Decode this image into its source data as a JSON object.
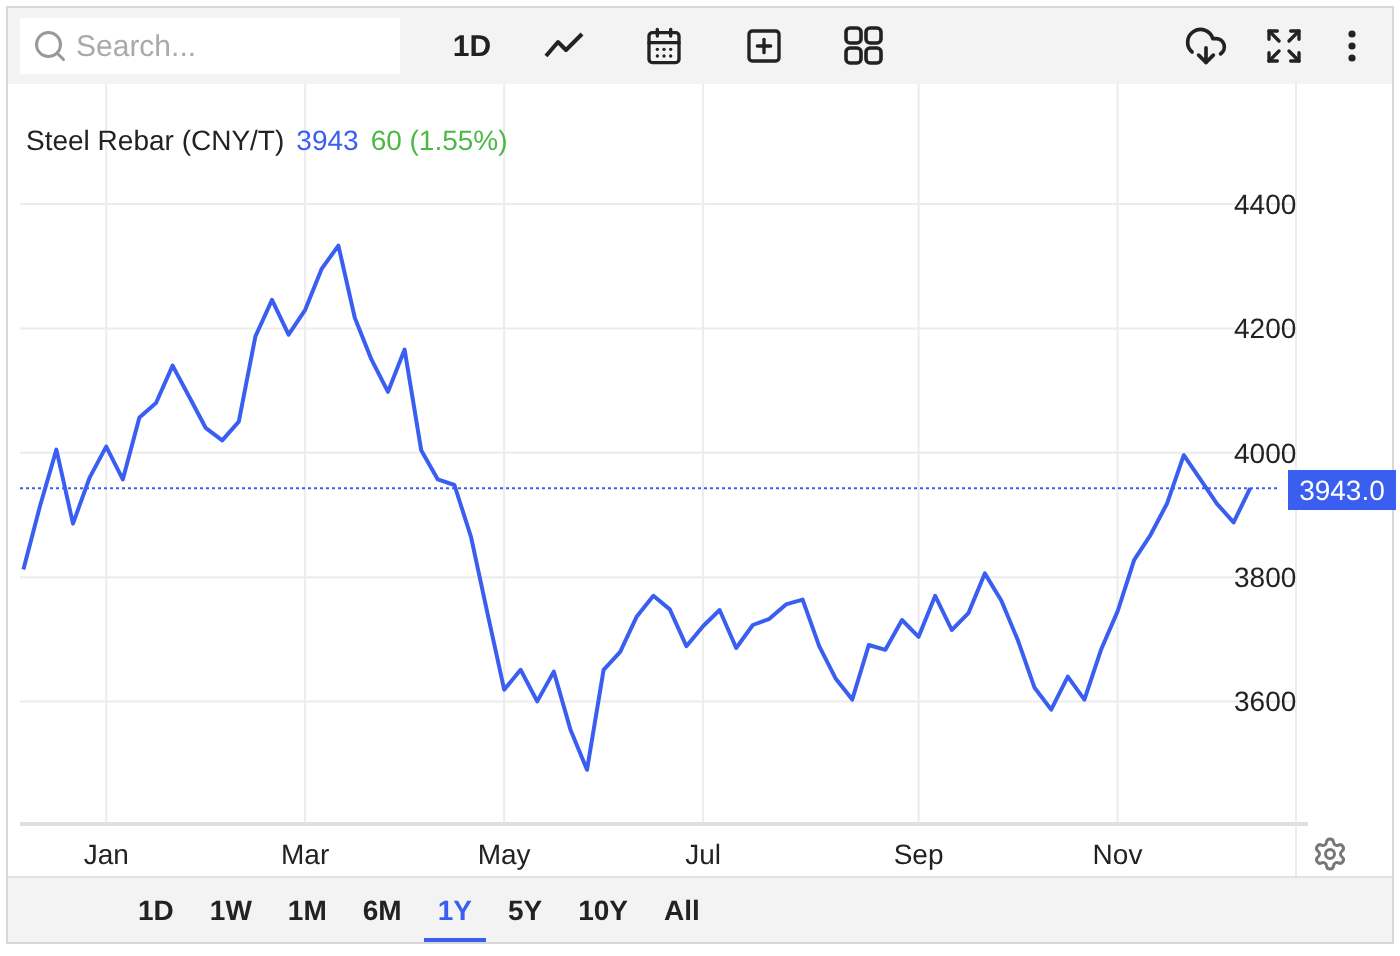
{
  "toolbar": {
    "search": {
      "placeholder": "Search..."
    },
    "interval": "1D"
  },
  "chart": {
    "legend": {
      "name": "Steel Rebar (CNY/T)",
      "price": "3943",
      "change": "60 (1.55%)"
    },
    "last_label": "3943.0",
    "chart_data": {
      "type": "line",
      "grid": true,
      "ylim": [
        3403,
        4593
      ],
      "ref_lines": [
        {
          "axis": "y",
          "value": 3943,
          "color": "#3a5ff0"
        }
      ],
      "categories": [
        null,
        null,
        null,
        null,
        null,
        "Jan",
        null,
        null,
        null,
        null,
        null,
        null,
        null,
        null,
        null,
        null,
        null,
        "Mar",
        null,
        null,
        null,
        null,
        null,
        null,
        null,
        null,
        null,
        null,
        null,
        "May",
        null,
        null,
        null,
        null,
        null,
        null,
        null,
        null,
        null,
        null,
        null,
        "Jul",
        null,
        null,
        null,
        null,
        null,
        null,
        null,
        null,
        null,
        null,
        null,
        null,
        "Sep",
        null,
        null,
        null,
        null,
        null,
        null,
        null,
        null,
        null,
        null,
        null,
        "Nov",
        null,
        null,
        null,
        null,
        null,
        null,
        null,
        null
      ],
      "yticks": [
        3600,
        3800,
        4000,
        4200,
        4400
      ],
      "series": [
        {
          "color": "#3a5ff0",
          "values": [
            3812,
            3913,
            4005,
            3886,
            3960,
            4010,
            3957,
            4057,
            4080,
            4140,
            4090,
            4040,
            4020,
            4050,
            4187,
            4246,
            4190,
            4230,
            4296,
            4333,
            4217,
            4150,
            4098,
            4166,
            4004,
            3957,
            3948,
            3865,
            3741,
            3619,
            3651,
            3600,
            3648,
            3555,
            3490,
            3651,
            3680,
            3737,
            3770,
            3748,
            3689,
            3721,
            3747,
            3686,
            3723,
            3733,
            3756,
            3764,
            3689,
            3637,
            3603,
            3691,
            3683,
            3731,
            3704,
            3770,
            3715,
            3742,
            3806,
            3762,
            3698,
            3622,
            3587,
            3640,
            3603,
            3683,
            3745,
            3828,
            3868,
            3919,
            3996,
            3957,
            3918,
            3888,
            3943
          ]
        }
      ]
    }
  },
  "ranges": [
    {
      "label": "1D",
      "selected": false
    },
    {
      "label": "1W",
      "selected": false
    },
    {
      "label": "1M",
      "selected": false
    },
    {
      "label": "6M",
      "selected": false
    },
    {
      "label": "1Y",
      "selected": true
    },
    {
      "label": "5Y",
      "selected": false
    },
    {
      "label": "10Y",
      "selected": false
    },
    {
      "label": "All",
      "selected": false
    }
  ]
}
